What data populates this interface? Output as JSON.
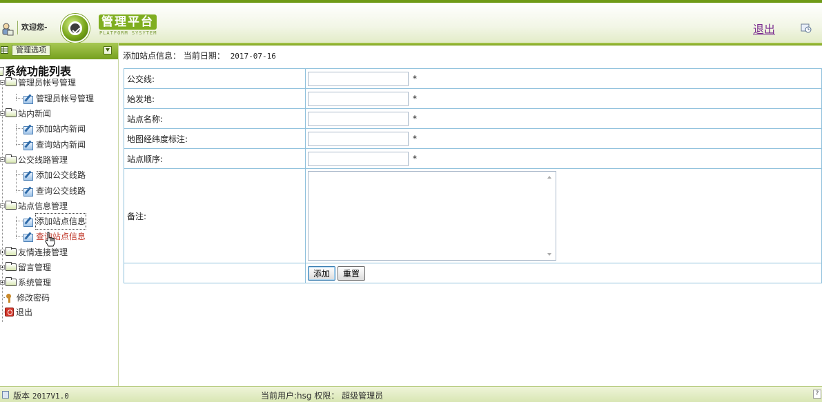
{
  "header": {
    "welcome": "欢迎您-",
    "brand_title": "管理平台",
    "brand_subtitle": "PLATFORM SYSYTEM",
    "logout": "退出"
  },
  "sidebar": {
    "header_button": "管理选项",
    "root": "系统功能列表",
    "items": [
      {
        "label": "管理员帐号管理"
      },
      {
        "label": "管理员帐号管理"
      },
      {
        "label": "站内新闻"
      },
      {
        "label": "添加站内新闻"
      },
      {
        "label": "查询站内新闻"
      },
      {
        "label": "公交线路管理"
      },
      {
        "label": "添加公交线路"
      },
      {
        "label": "查询公交线路"
      },
      {
        "label": "站点信息管理"
      },
      {
        "label": "添加站点信息"
      },
      {
        "label": "查询站点信息"
      },
      {
        "label": "友情连接管理"
      },
      {
        "label": "留言管理"
      },
      {
        "label": "系统管理"
      },
      {
        "label": "修改密码"
      },
      {
        "label": "退出"
      }
    ]
  },
  "main": {
    "heading_label": "添加站点信息：",
    "date_label": "当前日期：",
    "date_value": "2017-07-16",
    "fields": [
      {
        "label": "公交线:",
        "value": "",
        "required": "*"
      },
      {
        "label": "始发地:",
        "value": "",
        "required": "*"
      },
      {
        "label": "站点名称:",
        "value": "",
        "required": "*"
      },
      {
        "label": "地图经纬度标注:",
        "value": "",
        "required": "*"
      },
      {
        "label": "站点顺序:",
        "value": "",
        "required": "*"
      }
    ],
    "remark_label": "备注:",
    "remark_value": "",
    "add_button": "添加",
    "reset_button": "重置"
  },
  "footer": {
    "version_label": "版本",
    "version_value": "2017V1.0",
    "current_user": "当前用户:hsg 权限： 超级管理员"
  },
  "colors": {
    "brand_green": "#7fae1f",
    "table_border": "#8ec0dc",
    "active_link": "#c0392b",
    "logout_link": "#7a2b8f"
  }
}
